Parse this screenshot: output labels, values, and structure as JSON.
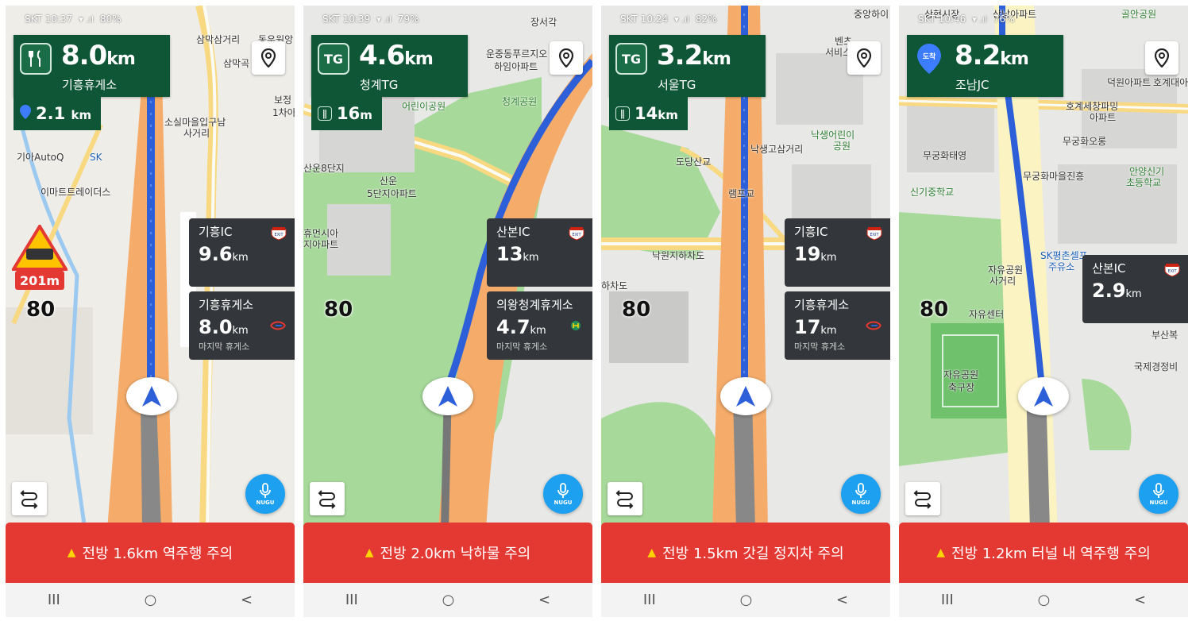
{
  "screens": [
    {
      "status": {
        "carrier_time": "SKT 10:37",
        "battery": "80%"
      },
      "tbt": {
        "icon": "fork-knife-icon",
        "distance": "8.0",
        "unit": "km",
        "name": "기흥휴게소"
      },
      "sub": {
        "icon": "destination-pin-icon",
        "distance": "2.1",
        "unit": "km"
      },
      "speed_limit": "80",
      "warning_sign": {
        "distance": "201m"
      },
      "cards": [
        {
          "name": "기흥IC",
          "distance": "9.6",
          "unit": "km",
          "note": "",
          "badge": "EXIT"
        },
        {
          "name": "기흥휴게소",
          "distance": "8.0",
          "unit": "km",
          "note": "마지막 휴게소",
          "badge": "ex-logo"
        }
      ],
      "alert": "전방 1.6km 역주행 주의",
      "map_labels": [
        "삼막삼거리",
        "동우원앙",
        "삼막곡",
        "소실마을입구남",
        "사거리",
        "기아AutoQ",
        "SK",
        "이마트트레이더스",
        "보정",
        "1차아"
      ]
    },
    {
      "status": {
        "carrier_time": "SKT 10:39",
        "battery": "79%"
      },
      "tbt": {
        "icon": "TG",
        "distance": "4.6",
        "unit": "km",
        "name": "청계TG"
      },
      "sub": {
        "icon": "fork-knife-icon",
        "distance": "16",
        "unit": "m"
      },
      "speed_limit": "80",
      "cards": [
        {
          "name": "산본IC",
          "distance": "13",
          "unit": "km",
          "note": "",
          "badge": "EXIT"
        },
        {
          "name": "의왕청계휴게소",
          "distance": "4.7",
          "unit": "km",
          "note": "마지막 휴게소",
          "badge": "rest-logo"
        }
      ],
      "alert": "전방 2.0km 낙하물 주의",
      "map_labels": [
        "장서각",
        "운중동푸르지오",
        "하임아파트",
        "청계공원",
        "어린이공원",
        "산운8단지",
        "산운",
        "5단지아파트",
        "휴먼시아",
        "지아파트"
      ]
    },
    {
      "status": {
        "carrier_time": "SKT 10:24",
        "battery": "82%"
      },
      "tbt": {
        "icon": "TG",
        "distance": "3.2",
        "unit": "km",
        "name": "서울TG"
      },
      "sub": {
        "icon": "fork-knife-icon",
        "distance": "14",
        "unit": "km"
      },
      "speed_limit": "80",
      "cards": [
        {
          "name": "기흥IC",
          "distance": "19",
          "unit": "km",
          "note": "",
          "badge": "EXIT"
        },
        {
          "name": "기흥휴게소",
          "distance": "17",
          "unit": "km",
          "note": "마지막 휴게소",
          "badge": "ex-logo"
        }
      ],
      "alert": "전방 1.5km 갓길 정지차 주의",
      "map_labels": [
        "중앙하이",
        "벤츠",
        "서비스센",
        "낙생어린이",
        "공원",
        "낙생고삼거리",
        "도당산교",
        "램프교",
        "낙원지하차도",
        "하차도"
      ]
    },
    {
      "status": {
        "carrier_time": "SKT 10:46",
        "battery": "76%"
      },
      "tbt": {
        "icon": "도착",
        "distance": "8.2",
        "unit": "km",
        "name": "조남JC"
      },
      "sub": null,
      "speed_limit": "80",
      "cards": [
        {
          "name": "산본IC",
          "distance": "2.9",
          "unit": "km",
          "note": "",
          "badge": "EXIT"
        }
      ],
      "alert": "전방 1.2km 터널 내 역주행 주의",
      "map_labels": [
        "상현시장",
        "상남아파트",
        "골안공원",
        "덕원아파트",
        "호계대아",
        "호계세창파밍",
        "아파트",
        "무궁화태영",
        "무궁화오롱",
        "안양신기",
        "초등학교",
        "신기중학교",
        "무궁화마을진흥",
        "SK평촌셀프",
        "주유소",
        "자유공원",
        "사거리",
        "자유센터",
        "자유공원",
        "축구장",
        "부산복",
        "국제경정비"
      ]
    }
  ],
  "nav": {
    "recents": "III",
    "home": "○",
    "back": "<"
  },
  "nugu_label": "NUGU",
  "colors": {
    "tbt_bg": "#0e5636",
    "route": "#2d5fd8",
    "road": "#f5ac6a",
    "alert_bg": "#e43933",
    "card_bg": "#33363a",
    "nugu": "#1ea0f0"
  }
}
